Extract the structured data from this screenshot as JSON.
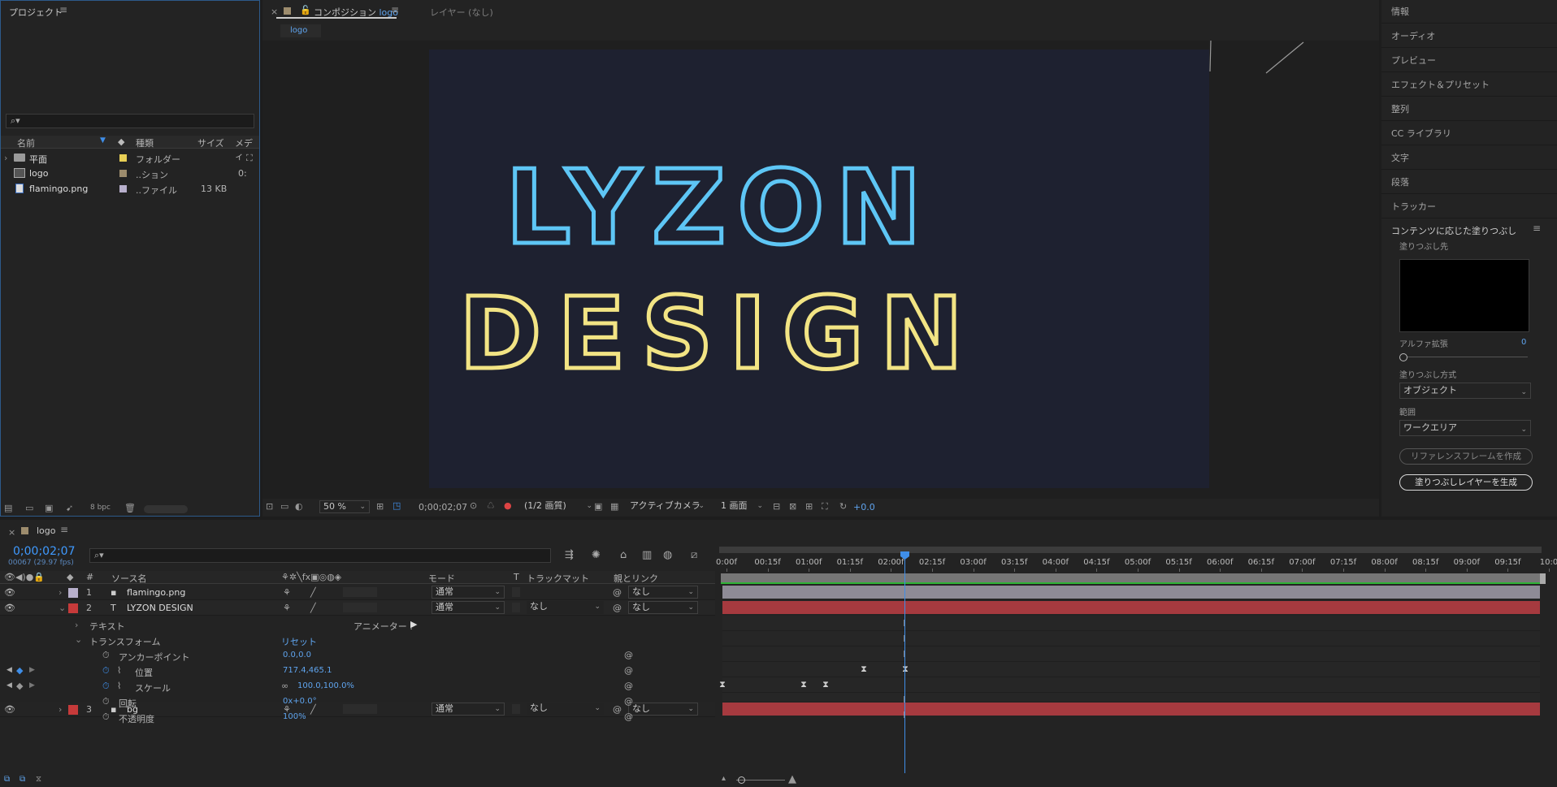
{
  "project": {
    "title": "プロジェクト",
    "search_placeholder": "",
    "columns": {
      "name": "名前",
      "type": "種類",
      "size": "サイズ",
      "media": "メディ"
    },
    "items": [
      {
        "name": "平面",
        "type": "フォルダー",
        "size": "",
        "extra": "",
        "color": "#e8cf55",
        "icon": "folder-icon"
      },
      {
        "name": "logo",
        "type": "..ション",
        "size": "",
        "extra": "0:",
        "color": "#9d8c6d",
        "icon": "composition-icon"
      },
      {
        "name": "flamingo.png",
        "type": "..ファイル",
        "size": "13 KB",
        "extra": "",
        "color": "#b8b0cc",
        "icon": "image-file-icon"
      }
    ],
    "bpc": "8 bpc"
  },
  "viewer": {
    "tab_prefix": "コンポジション",
    "tab_comp": "logo",
    "layer_tab": "レイヤー (なし)",
    "breadcrumb": "logo",
    "text_line1": "LYZON",
    "text_line2": "DESIGN",
    "line1_color": "#5ec6f5",
    "line2_color": "#f2e484",
    "bg_color": "#1e2130",
    "zoom": "50 %",
    "timecode": "0;00;02;07",
    "resolution": "(1/2 画質)",
    "camera": "アクティブカメラ",
    "views": "1 画面",
    "exposure": "+0.0"
  },
  "right_panel": {
    "items": [
      "情報",
      "オーディオ",
      "プレビュー",
      "エフェクト＆プリセット",
      "整列",
      "CC ライブラリ",
      "文字",
      "段落",
      "トラッカー"
    ],
    "fill": {
      "title": "コンテンツに応じた塗りつぶし",
      "target_label": "塗りつぶし先",
      "alpha_label": "アルファ拡張",
      "alpha_value": "0",
      "method_label": "塗りつぶし方式",
      "method_value": "オブジェクト",
      "range_label": "範囲",
      "range_value": "ワークエリア",
      "ref_button": "リファレンスフレームを作成",
      "gen_button": "塗りつぶしレイヤーを生成"
    }
  },
  "timeline": {
    "tab": "logo",
    "timecode": "0;00;02;07",
    "fps": "00067 (29.97 fps)",
    "search_placeholder": "",
    "columns": {
      "num": "#",
      "source": "ソース名",
      "mode": "モード",
      "t": "T",
      "track": "トラックマット",
      "parent": "親とリンク"
    },
    "layers": [
      {
        "num": "1",
        "name": "flamingo.png",
        "color": "#b8b0cc",
        "mode": "通常",
        "track": "",
        "parent": "なし",
        "icon": "image-file-icon"
      },
      {
        "num": "2",
        "name": "LYZON DESIGN",
        "color": "#c63a3a",
        "mode": "通常",
        "track": "なし",
        "parent": "なし",
        "icon": "text-layer-icon"
      },
      {
        "num": "3",
        "name": "bg",
        "color": "#c63a3a",
        "mode": "通常",
        "track": "なし",
        "parent": "なし",
        "icon": "solid-layer-icon"
      }
    ],
    "text_group": "テキスト",
    "animator": "アニメーター :",
    "transform_group": "トランスフォーム",
    "reset": "リセット",
    "props": [
      {
        "name": "アンカーポイント",
        "value": "0.0,0.0"
      },
      {
        "name": "位置",
        "value": "717.4,465.1"
      },
      {
        "name": "スケール",
        "value": "100.0,100.0%"
      },
      {
        "name": "回転",
        "value": "0x+0.0°"
      },
      {
        "name": "不透明度",
        "value": "100%"
      }
    ],
    "ruler": [
      "0:00f",
      "00:15f",
      "01:00f",
      "01:15f",
      "02:00f",
      "02:15f",
      "03:00f",
      "03:15f",
      "04:00f",
      "04:15f",
      "05:00f",
      "05:15f",
      "06:00f",
      "06:15f",
      "07:00f",
      "07:15f",
      "08:00f",
      "08:15f",
      "09:00f",
      "09:15f",
      "10:0"
    ]
  }
}
